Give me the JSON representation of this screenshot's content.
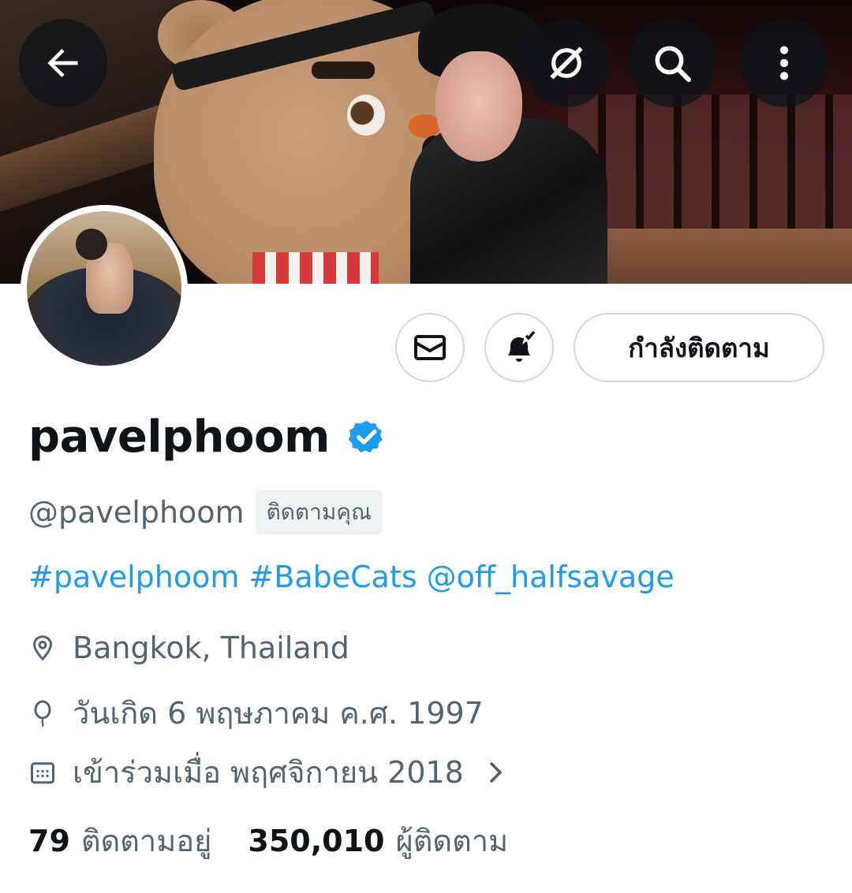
{
  "profile": {
    "display_name": "pavelphoom",
    "handle": "@pavelphoom",
    "follows_you_badge": "ติดตามคุณ",
    "bio": {
      "tags": [
        "#pavelphoom",
        "#BabeCats",
        "@off_halfsavage"
      ]
    },
    "location": "Bangkok, Thailand",
    "birthday": "วันเกิด 6 พฤษภาคม ค.ศ. 1997",
    "joined": "เข้าร่วมเมื่อ พฤศจิกายน 2018",
    "stats": {
      "following_count": "79",
      "following_label": "ติดตามอยู่",
      "followers_count": "350,010",
      "followers_label": "ผู้ติดตาม"
    }
  },
  "actions": {
    "following_button": "กำลังติดตาม"
  },
  "icons": {
    "back": "back-arrow-icon",
    "grok": "grok-icon",
    "search": "search-icon",
    "more": "more-vertical-icon",
    "message": "envelope-icon",
    "notify": "bell-check-icon",
    "verified": "verified-badge-icon",
    "location": "location-pin-icon",
    "birthday": "balloon-icon",
    "joined": "calendar-icon",
    "chevron": "chevron-right-icon"
  },
  "colors": {
    "accent": "#1d9bf0",
    "secondary_text": "#536471",
    "primary_text": "#0f1419",
    "border": "#cfd9de"
  }
}
